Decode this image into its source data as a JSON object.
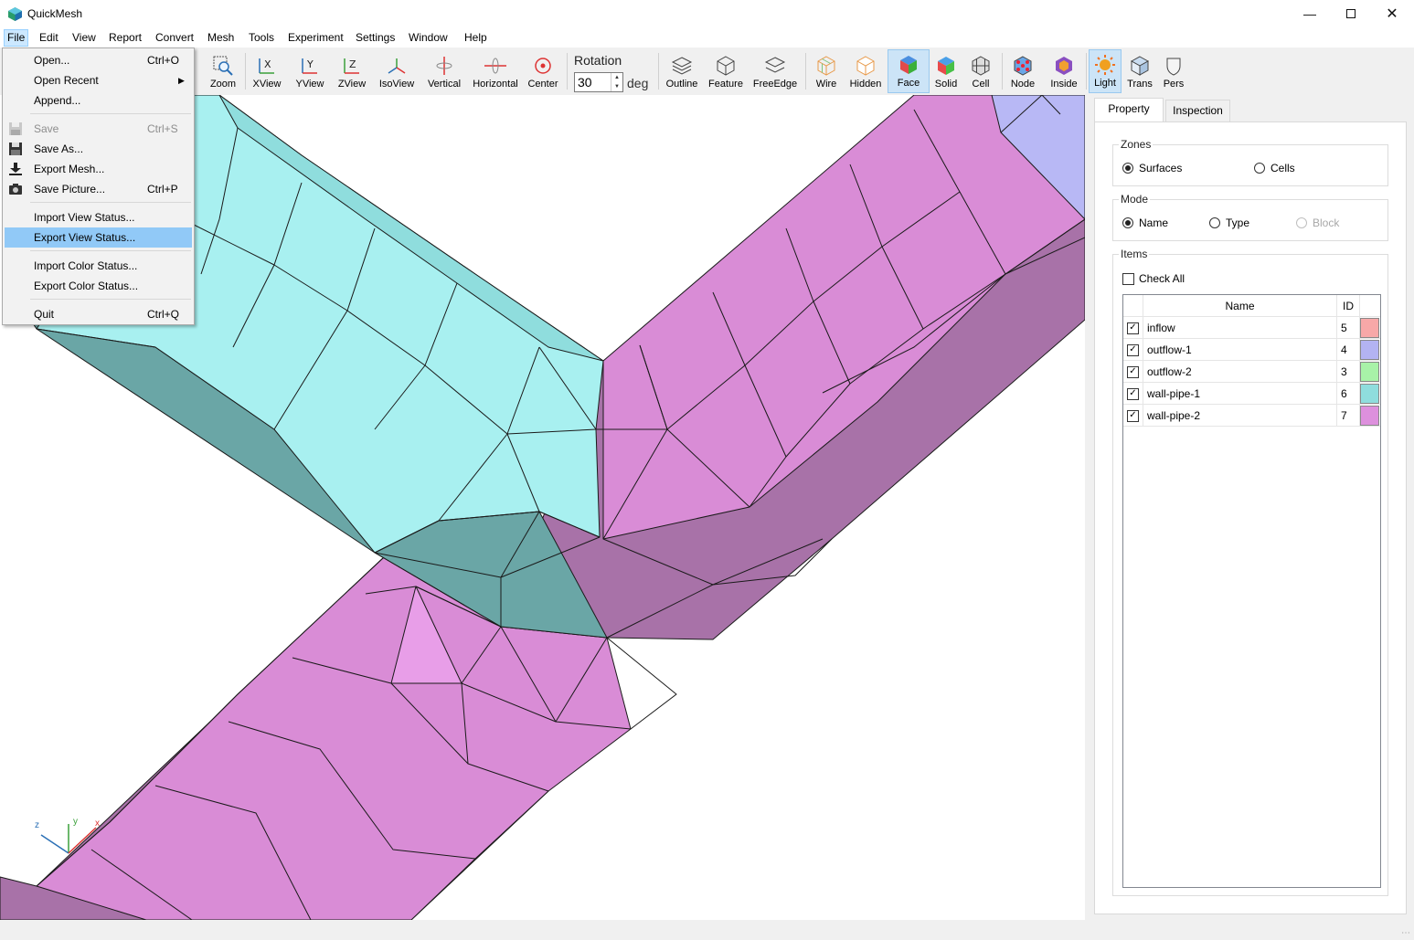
{
  "app": {
    "title": "QuickMesh"
  },
  "menubar": [
    "File",
    "Edit",
    "View",
    "Report",
    "Convert",
    "Mesh",
    "Tools",
    "Experiment",
    "Settings",
    "Window",
    "Help"
  ],
  "toolbar": {
    "zoom": "Zoom",
    "xview": "XView",
    "yview": "YView",
    "zview": "ZView",
    "isoview": "IsoView",
    "vertical": "Vertical",
    "horizontal": "Horizontal",
    "center": "Center",
    "rotation_label": "Rotation",
    "rotation_value": "30",
    "rotation_unit": "deg",
    "outline": "Outline",
    "feature": "Feature",
    "freeedge": "FreeEdge",
    "wire": "Wire",
    "hidden": "Hidden",
    "face": "Face",
    "solid": "Solid",
    "cell": "Cell",
    "node": "Node",
    "inside": "Inside",
    "light": "Light",
    "trans": "Trans",
    "pers": "Pers"
  },
  "file_menu": {
    "open": "Open...",
    "open_sc": "Ctrl+O",
    "open_recent": "Open Recent",
    "append": "Append...",
    "save": "Save",
    "save_sc": "Ctrl+S",
    "save_as": "Save As...",
    "export_mesh": "Export Mesh...",
    "save_picture": "Save Picture...",
    "save_picture_sc": "Ctrl+P",
    "import_view": "Import View Status...",
    "export_view": "Export View Status...",
    "import_color": "Import Color Status...",
    "export_color": "Export Color Status...",
    "quit": "Quit",
    "quit_sc": "Ctrl+Q"
  },
  "panel": {
    "tabs": [
      "Property",
      "Inspection"
    ],
    "zones": {
      "title": "Zones",
      "surfaces": "Surfaces",
      "cells": "Cells",
      "selected": "Surfaces"
    },
    "mode": {
      "title": "Mode",
      "name": "Name",
      "type": "Type",
      "block": "Block",
      "selected": "Name"
    },
    "items": {
      "title": "Items",
      "check_all": "Check All",
      "columns": [
        "Name",
        "ID"
      ],
      "rows": [
        {
          "name": "inflow",
          "id": "5",
          "color": "#f7a8a8",
          "checked": true
        },
        {
          "name": "outflow-1",
          "id": "4",
          "color": "#b3b3f2",
          "checked": true
        },
        {
          "name": "outflow-2",
          "id": "3",
          "color": "#a8f2a8",
          "checked": true
        },
        {
          "name": "wall-pipe-1",
          "id": "6",
          "color": "#8fdddd",
          "checked": true
        },
        {
          "name": "wall-pipe-2",
          "id": "7",
          "color": "#dd90dd",
          "checked": true
        }
      ]
    }
  },
  "axes": {
    "x": "x",
    "y": "y",
    "z": "z"
  },
  "colors": {
    "pipe1_top": "#a8f0f0",
    "pipe1_side": "#6aa6a6",
    "pipe2_top": "#d98cd6",
    "pipe2_side": "#a874a8",
    "outflow": "#b8b8f5"
  }
}
